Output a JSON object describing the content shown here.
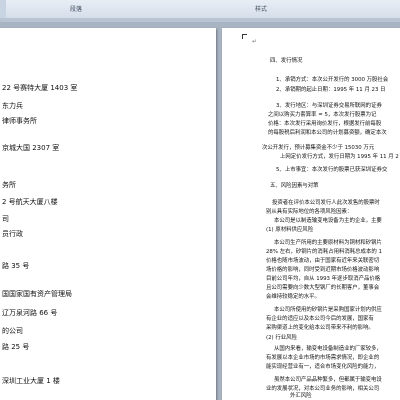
{
  "ribbon": {
    "group_paragraph": "段落",
    "group_styles": "样式"
  },
  "left_page": {
    "lines": [
      "22 号赛特大厦 1403 室",
      "东力兵",
      "律师事务所",
      "京城大国 2307 室",
      "务所",
      "2 号航天大厦八楼",
      "司",
      "员行政",
      "路 35 号",
      "国国家国有资产管理局",
      "辽万泉河路 66 号",
      "的公司",
      "路 25 号",
      "深圳工业大厦 1 楼"
    ]
  },
  "right_page": {
    "lines": [
      "四、发行情况",
      "1、承销方式：本次公开发行的 3000 万股社会",
      "2、承销期的起止日期：1995 年 11 月 23 日",
      "3、发行地区：与深圳证券交易所联网的证券",
      "之间以购买力套算率 = 5，本次发行股票为记",
      "价格：本次发行采用询价发行，根据发行前每股",
      "的每股税后利润和本公司的计划募资额，确定本次",
      "次公开发行，预计募集资金不少于 15030 万元",
      "上网定价发行方式，发行日期为 1995 年 11 月 2",
      "5、上市事宜：本次发行的股票已获深圳证券交",
      "五、风险因素与对策",
      "投资者在评价本公司发行人此次发售的股票时",
      "别从具有实际地位的各项风险因素：",
      "本公司是以制造输变电设备为主的企业，主要",
      "(1) 原材料供应风险",
      "本公司生产所用的主要原材料为铜材和矽钢片",
      "28% 左右，矽钢片的消耗占用料消耗总成本的 1",
      "价格也随市场波动，由于国家有近年来关联密切",
      "场价格的影响，同时受到近期市场价格波动影响",
      "目前公司年均，自从 1993 年逐步取消产品价格",
      "且公司需要向少数大型钢厂的长期客户，董事会",
      "会维持较稳定的水平。",
      "本公司所使用的矽钢片是采购国家计划内供应",
      "有企业的适应以及本公司今后的发展，国家有",
      "采购渠道上的变化给本公司带来不利的影响。",
      "(2) 行业风险",
      "从国内来看，输变电设备制造业的厂家较多，",
      "有发展以本企业市场的市场需求情况，即企业的",
      "能实现经营业有一，适合市场变化风险的能力，",
      "虽然本公司产品品种繁多，但都属于输变电设",
      "业的发展状况，对本公司业务的影响，相关公司",
      "外汇风险"
    ]
  }
}
